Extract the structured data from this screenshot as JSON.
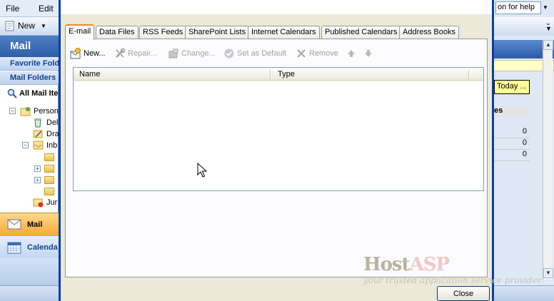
{
  "outlook": {
    "menu": {
      "file": "File",
      "edit": "Edit"
    },
    "toolbar": {
      "new_label": "New"
    },
    "nav": {
      "title": "Mail",
      "favorite_folders": "Favorite Fold",
      "mail_folders": "Mail Folders",
      "all_mail_items": "All Mail Ite",
      "tree": [
        {
          "label": "Person",
          "indent": 0
        },
        {
          "label": "Del",
          "indent": 1
        },
        {
          "label": "Dra",
          "indent": 1
        },
        {
          "label": "Inb",
          "indent": 0
        },
        {
          "label": "",
          "indent": 2
        },
        {
          "label": "",
          "indent": 2
        },
        {
          "label": "",
          "indent": 2
        },
        {
          "label": "",
          "indent": 2
        },
        {
          "label": "Jur",
          "indent": 1
        }
      ],
      "mail_button": "Mail",
      "calendar_button": "Calenda"
    },
    "help_box_text": "on for help",
    "today_button": "Today ...",
    "results_header": "es",
    "result_values": [
      "0",
      "0",
      "0"
    ]
  },
  "dialog": {
    "tabs": [
      "E-mail",
      "Data Files",
      "RSS Feeds",
      "SharePoint Lists",
      "Internet Calendars",
      "Published Calendars",
      "Address Books"
    ],
    "active_tab": "E-mail",
    "actions": {
      "new": "New...",
      "repair": "Repair...",
      "change": "Change...",
      "set_default": "Set as Default",
      "remove": "Remove"
    },
    "columns": {
      "name": "Name",
      "type": "Type"
    },
    "close_label": "Close"
  },
  "watermark": {
    "brand_host": "Host",
    "brand_asp": "ASP",
    "tagline": "your trusted application service provider"
  },
  "colors": {
    "dialog_border": "#0a3fa8",
    "active_tab_accent": "#e68b2c",
    "watermark_host": "#b9b2a0",
    "watermark_asp": "#f2c7c7"
  }
}
